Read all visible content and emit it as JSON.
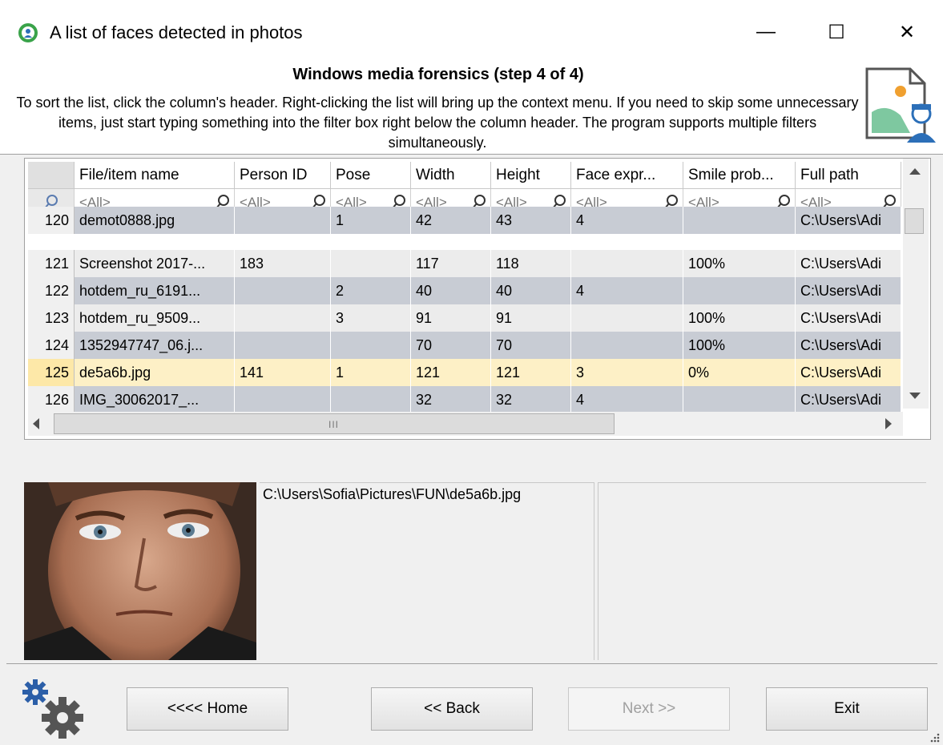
{
  "window": {
    "title": "A list of faces detected in photos",
    "minimize_glyph": "—",
    "maximize_glyph": "☐",
    "close_glyph": "✕"
  },
  "header": {
    "step_title": "Windows media forensics (step 4 of 4)",
    "description": "To sort the list, click the column's header. Right-clicking the list will bring up the context menu. If you need to skip some unnecessary items, just start typing something into the filter box right below the column header. The program supports multiple filters simultaneously."
  },
  "grid": {
    "columns": [
      "",
      "File/item name",
      "Person ID",
      "Pose",
      "Width",
      "Height",
      "Face expr...",
      "Smile prob...",
      "Full path"
    ],
    "filter_placeholder": "<All>",
    "rows": [
      {
        "num": "120",
        "name": "demot0888.jpg",
        "person": "",
        "pose": "1",
        "width": "42",
        "height": "43",
        "face": "4",
        "smile": "",
        "path": "C:\\Users\\Adi"
      },
      {
        "num": "121",
        "name": "Screenshot 2017-...",
        "person": "183",
        "pose": "",
        "width": "117",
        "height": "118",
        "face": "",
        "smile": "100%",
        "path": "C:\\Users\\Adi"
      },
      {
        "num": "122",
        "name": "hotdem_ru_6191...",
        "person": "",
        "pose": "2",
        "width": "40",
        "height": "40",
        "face": "4",
        "smile": "",
        "path": "C:\\Users\\Adi"
      },
      {
        "num": "123",
        "name": "hotdem_ru_9509...",
        "person": "",
        "pose": "3",
        "width": "91",
        "height": "91",
        "face": "",
        "smile": "100%",
        "path": "C:\\Users\\Adi"
      },
      {
        "num": "124",
        "name": "1352947747_06.j...",
        "person": "",
        "pose": "",
        "width": "70",
        "height": "70",
        "face": "",
        "smile": "100%",
        "path": "C:\\Users\\Adi"
      },
      {
        "num": "125",
        "name": "de5a6b.jpg",
        "person": "141",
        "pose": "1",
        "width": "121",
        "height": "121",
        "face": "3",
        "smile": "0%",
        "path": "C:\\Users\\Adi"
      },
      {
        "num": "126",
        "name": "IMG_30062017_...",
        "person": "",
        "pose": "",
        "width": "32",
        "height": "32",
        "face": "4",
        "smile": "",
        "path": "C:\\Users\\Adi"
      }
    ],
    "hscroll_grip": "III"
  },
  "preview": {
    "path": "C:\\Users\\Sofia\\Pictures\\FUN\\de5a6b.jpg"
  },
  "buttons": {
    "home": "<<<< Home",
    "back": "<< Back",
    "next": "Next >>",
    "exit": "Exit"
  }
}
